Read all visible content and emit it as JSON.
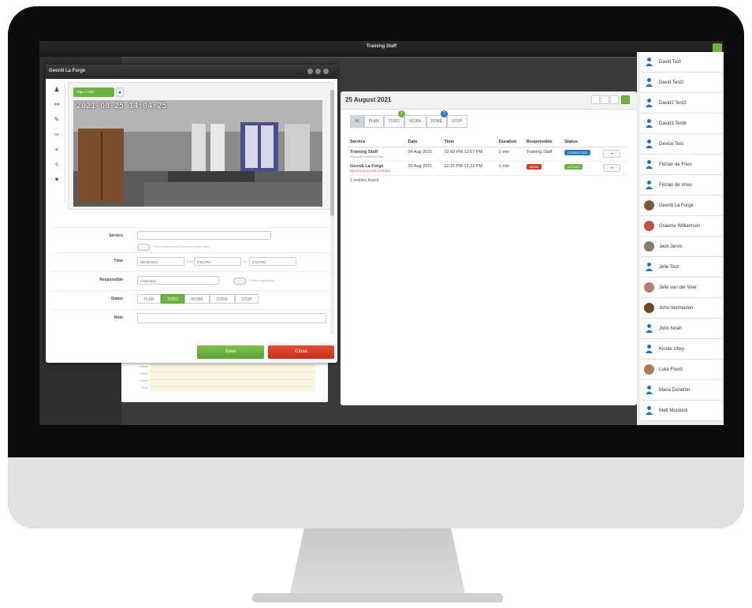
{
  "app": {
    "title": "Training Staff"
  },
  "dialog": {
    "title": "Geordi La Forge",
    "camera_select": "Tapo C100",
    "camera_timestamp": "2021-08-25 14:04:25",
    "service_label": "Service",
    "service_value": "",
    "phone_notification_before": "Phone notification 0 minutes before time",
    "time_label": "Time",
    "date_value": "08/25/2021",
    "from_label": "from",
    "from_value": "3:03 PM",
    "to_label": "to",
    "to_value": "3:13 PM",
    "responsible_label": "Responsible",
    "responsible_value": "Automatic",
    "phone_notification": "Phone notification",
    "status_label": "Status",
    "status_options": [
      "PLAN",
      "TODO",
      "WORK",
      "DONE",
      "STOP"
    ],
    "status_selected": "TODO",
    "note_label": "Note",
    "save_label": "Save",
    "close_label": "Close"
  },
  "center": {
    "date": "25 August 2021",
    "tabs": [
      "All",
      "PLAN",
      "TODO",
      "WORK",
      "DONE",
      "STOP"
    ],
    "tab_badges": {
      "TODO": "1",
      "DONE": "2"
    },
    "columns": [
      "Service",
      "Date",
      "Time",
      "Duration",
      "Responsible",
      "Status"
    ],
    "rows": [
      {
        "service": "Training Staff",
        "sub": "Physical Wellbeing Visit",
        "date": "04 Aug 2021",
        "time": "12:50 PM 12:57 PM",
        "duration": "2 min",
        "responsible": "Training Staff",
        "status": "COMPLETED",
        "status_color": "#2a7bbf"
      },
      {
        "service": "Geordi La Forge",
        "sub": "BEDROOM DOOR OPENED",
        "date": "25 Aug 2021",
        "time": "12:21 PM 12:22 PM",
        "duration": "1 min",
        "responsible": "NONE",
        "status": "ACTIVE",
        "status_color": "#6cb33f"
      }
    ],
    "entries_found": "2 entries found"
  },
  "background_panel": {
    "rows": [
      "4.0tpm",
      "4.0tpm",
      "4.0tpm",
      "Free"
    ]
  },
  "people": [
    {
      "name": "David Test",
      "avatar": "default"
    },
    {
      "name": "David Test2",
      "avatar": "default"
    },
    {
      "name": "David2 Test3",
      "avatar": "default"
    },
    {
      "name": "David3 Test6",
      "avatar": "default"
    },
    {
      "name": "Device Test",
      "avatar": "default"
    },
    {
      "name": "Florian de Fries",
      "avatar": "default"
    },
    {
      "name": "Florian de Vries",
      "avatar": "default"
    },
    {
      "name": "Geordi La Forge",
      "avatar": "#7a5a3a"
    },
    {
      "name": "Graeme Williamson",
      "avatar": "#c0504d"
    },
    {
      "name": "Jack Jarvis",
      "avatar": "#8a7a6a"
    },
    {
      "name": "Jelle Test",
      "avatar": "default"
    },
    {
      "name": "Jelle van der Veer",
      "avatar": "#b08070"
    },
    {
      "name": "John Vermeulen",
      "avatar": "#6a4a2a"
    },
    {
      "name": "John Noah",
      "avatar": "default"
    },
    {
      "name": "Kirstie Utley",
      "avatar": "default"
    },
    {
      "name": "Luke Flood",
      "avatar": "#b07850"
    },
    {
      "name": "Maria Doneton",
      "avatar": "default"
    },
    {
      "name": "Matt Murdock",
      "avatar": "default"
    }
  ],
  "colors": {
    "accent_green": "#6cb33f",
    "close_red": "#d83a22",
    "completed_blue": "#2a7bbf"
  },
  "icons": [
    "user-icon",
    "link-icon",
    "pencil-icon",
    "infinity-icon",
    "plus-icon",
    "share-icon",
    "heart-icon",
    "calendar-icon",
    "clock-icon"
  ]
}
